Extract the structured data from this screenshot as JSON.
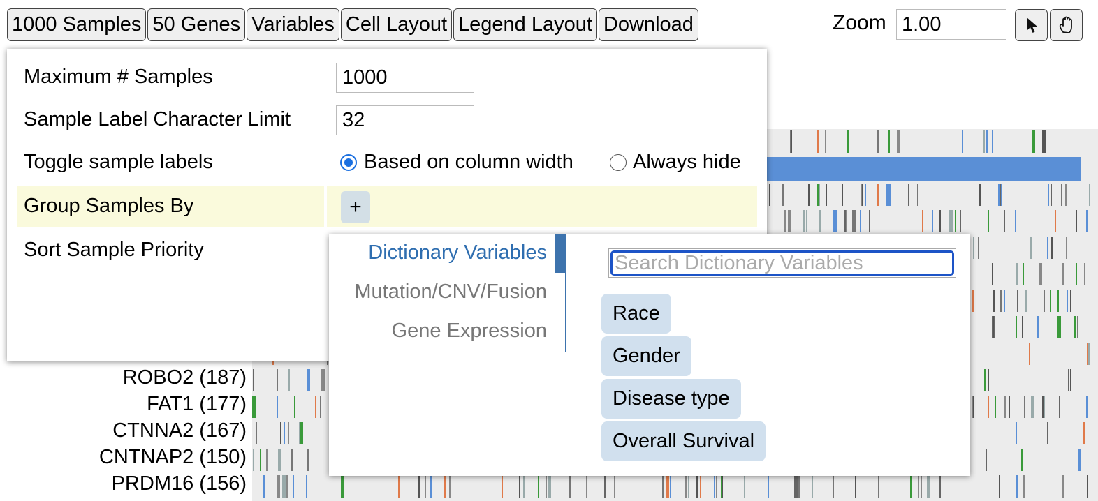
{
  "toolbar": {
    "buttons": [
      "1000 Samples",
      "50 Genes",
      "Variables",
      "Cell Layout",
      "Legend Layout",
      "Download"
    ],
    "zoom_label": "Zoom",
    "zoom_value": "1.00",
    "icons": [
      "pointer-arrow-icon",
      "hand-pan-icon"
    ]
  },
  "gene_labels": [
    "ROBO2 (187)",
    "FAT1 (177)",
    "CTNNA2 (167)",
    "CNTNAP2 (150)",
    "PRDM16 (156)"
  ],
  "panel": {
    "max_samples_label": "Maximum # Samples",
    "max_samples_value": "1000",
    "char_limit_label": "Sample Label Character Limit",
    "char_limit_value": "32",
    "toggle_label": "Toggle sample labels",
    "toggle_options": [
      {
        "label": "Based on column width",
        "checked": true
      },
      {
        "label": "Always hide",
        "checked": false
      }
    ],
    "group_label": "Group Samples By",
    "group_add": "+",
    "sort_label": "Sort Sample Priority"
  },
  "dropdown": {
    "tabs": [
      {
        "label": "Dictionary Variables",
        "active": true
      },
      {
        "label": "Mutation/CNV/Fusion",
        "active": false
      },
      {
        "label": "Gene Expression",
        "active": false
      }
    ],
    "search_placeholder": "Search Dictionary Variables",
    "variables": [
      "Race",
      "Gender",
      "Disease type",
      "Overall Survival"
    ]
  },
  "colors": {
    "accent": "#1a6fe0",
    "tab_active": "#2f6eb0",
    "highlight_row": "#fafadc",
    "chip_bg": "#d1e0ee",
    "matrix_bg": "#ececec",
    "mutation_blue": "#5a8fd6"
  }
}
